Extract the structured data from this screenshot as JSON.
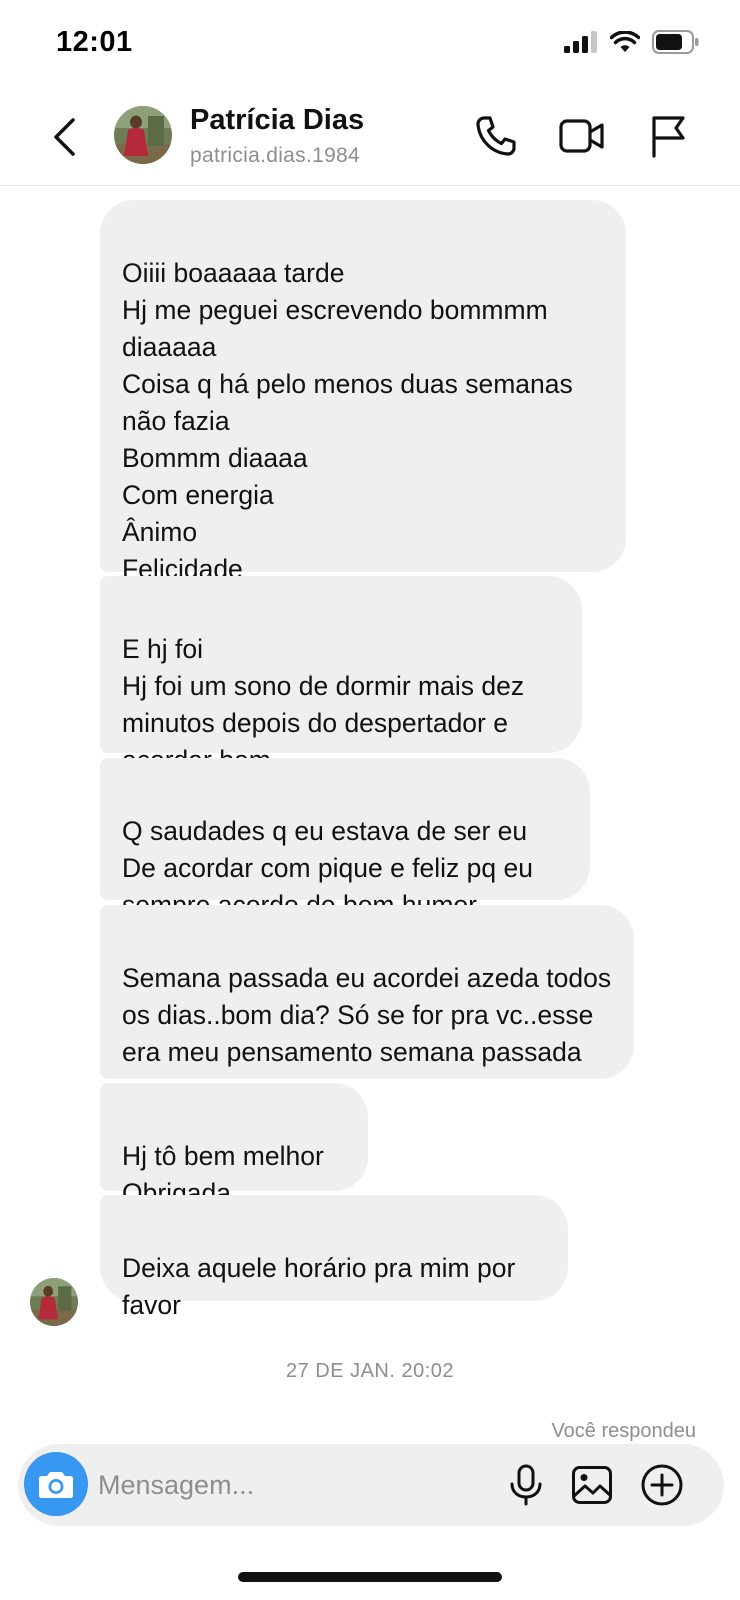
{
  "status_bar": {
    "time": "12:01"
  },
  "header": {
    "contact_name": "Patrícia Dias",
    "contact_handle": "patricia.dias.1984"
  },
  "messages": [
    {
      "text": "Oiiii boaaaaa tarde\nHj me peguei escrevendo bommmm diaaaaa\nCoisa q há pelo menos duas semanas não fazia\nBommm diaaaa\nCom energia\nÂnimo\nFelicidade"
    },
    {
      "text": "E hj foi\nHj foi um sono de dormir mais dez minutos depois do despertador e acordar bem"
    },
    {
      "text": "Q saudades q eu estava de ser eu\nDe acordar com pique e feliz pq eu sempre acordo de bom humor"
    },
    {
      "text": "Semana passada eu acordei azeda todos os dias..bom dia? Só se for pra vc..esse era meu pensamento semana passada"
    },
    {
      "text": "Hj tô bem melhor\nObrigada"
    },
    {
      "text": "Deixa aquele horário pra mim por favor"
    }
  ],
  "timestamp": "27 DE JAN. 20:02",
  "replied_label": "Você respondeu",
  "composer": {
    "placeholder": "Mensagem..."
  },
  "colors": {
    "accent": "#3897f0",
    "bubble": "#efefef",
    "muted": "#8e8e8e"
  },
  "icons": [
    "back-icon",
    "phone-icon",
    "video-icon",
    "flag-icon",
    "camera-icon",
    "microphone-icon",
    "gallery-icon",
    "plus-icon"
  ]
}
